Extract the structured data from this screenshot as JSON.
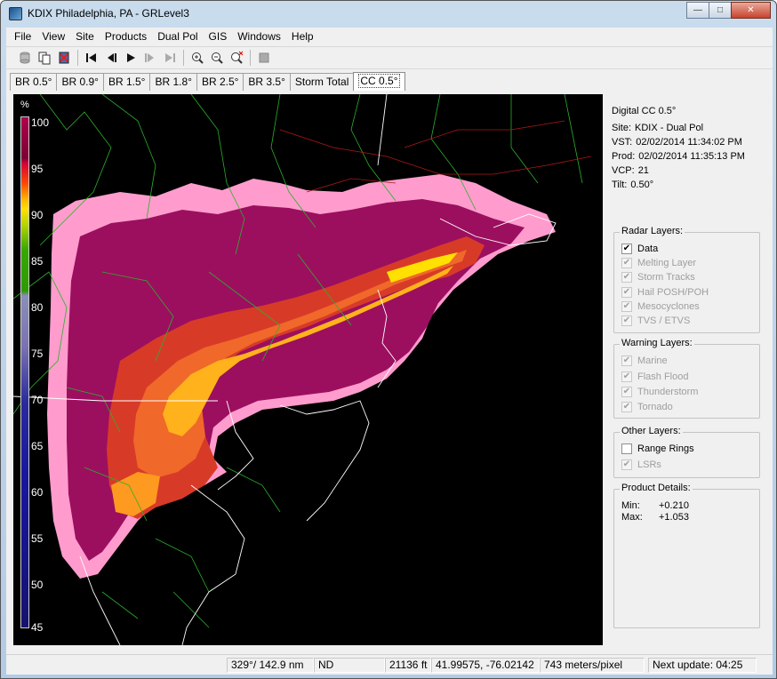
{
  "window": {
    "title": "KDIX Philadelphia, PA - GRLevel3",
    "minimize_glyph": "—",
    "maximize_glyph": "□",
    "close_glyph": "✕"
  },
  "menu": [
    "File",
    "View",
    "Site",
    "Products",
    "Dual Pol",
    "GIS",
    "Windows",
    "Help"
  ],
  "toolbar": {
    "icons": [
      "database-icon",
      "copy-icon",
      "delete-icon",
      "skip-start-icon",
      "step-back-icon",
      "play-icon",
      "step-forward-icon",
      "skip-end-icon",
      "zoom-in-icon",
      "zoom-out-icon",
      "zoom-reset-icon",
      "stop-icon"
    ]
  },
  "tabs": [
    {
      "label": "BR 0.5°",
      "active": false
    },
    {
      "label": "BR 0.9°",
      "active": false
    },
    {
      "label": "BR 1.5°",
      "active": false
    },
    {
      "label": "BR 1.8°",
      "active": false
    },
    {
      "label": "BR 2.5°",
      "active": false
    },
    {
      "label": "BR 3.5°",
      "active": false
    },
    {
      "label": "Storm Total",
      "active": false
    },
    {
      "label": "CC 0.5°",
      "active": true
    }
  ],
  "legend": {
    "unit": "%",
    "ticks": [
      "100",
      "95",
      "90",
      "85",
      "80",
      "75",
      "70",
      "65",
      "60",
      "55",
      "50",
      "45"
    ]
  },
  "info": {
    "product": "Digital CC 0.5°",
    "site_label": "Site:",
    "site": "KDIX - Dual Pol",
    "vst_label": "VST:",
    "vst": "02/02/2014  11:34:02 PM",
    "prod_label": "Prod:",
    "prod": "02/02/2014  11:35:13 PM",
    "vcp_label": "VCP:",
    "vcp": "21",
    "tilt_label": "Tilt:",
    "tilt": "0.50°"
  },
  "radar_layers": {
    "title": "Radar Layers:",
    "items": [
      {
        "label": "Data",
        "checked": true,
        "enabled": true
      },
      {
        "label": "Melting Layer",
        "checked": true,
        "enabled": false
      },
      {
        "label": "Storm Tracks",
        "checked": true,
        "enabled": false
      },
      {
        "label": "Hail POSH/POH",
        "checked": true,
        "enabled": false
      },
      {
        "label": "Mesocyclones",
        "checked": true,
        "enabled": false
      },
      {
        "label": "TVS / ETVS",
        "checked": true,
        "enabled": false
      }
    ]
  },
  "warning_layers": {
    "title": "Warning Layers:",
    "items": [
      {
        "label": "Marine",
        "checked": true,
        "enabled": false
      },
      {
        "label": "Flash Flood",
        "checked": true,
        "enabled": false
      },
      {
        "label": "Thunderstorm",
        "checked": true,
        "enabled": false
      },
      {
        "label": "Tornado",
        "checked": true,
        "enabled": false
      }
    ]
  },
  "other_layers": {
    "title": "Other Layers:",
    "items": [
      {
        "label": "Range Rings",
        "checked": false,
        "enabled": true
      },
      {
        "label": "LSRs",
        "checked": true,
        "enabled": false
      }
    ]
  },
  "product_details": {
    "title": "Product Details:",
    "min_label": "Min:",
    "min": "+0.210",
    "max_label": "Max:",
    "max": "+1.053"
  },
  "status": {
    "azimuth_range": "329°/ 142.9 nm",
    "value": "ND",
    "height": "21136 ft",
    "coords": "41.99575, -76.02142",
    "resolution": "743 meters/pixel",
    "next_update": "Next update: 04:25"
  }
}
